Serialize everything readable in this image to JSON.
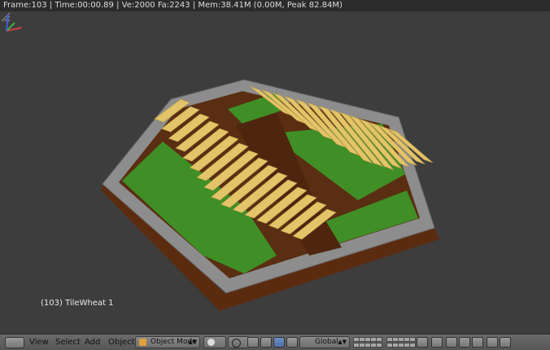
{
  "info_bar": {
    "text": "Frame:103 | Time:00:00.89 | Ve:2000 Fa:2243 | Mem:38.41M (0.00M, Peak 82.84M)"
  },
  "viewport": {
    "object_label": "(103) TileWheat 1",
    "colors": {
      "background": "#3d3d3d",
      "border_stone": "#8c8c8c",
      "grass": "#3e8f24",
      "dirt": "#5a2e12",
      "wheat": "#e3c468"
    }
  },
  "header": {
    "menu": {
      "view": "View",
      "select": "Select",
      "add": "Add",
      "object": "Object"
    },
    "mode": "Object Mode",
    "orientation": "Global"
  }
}
